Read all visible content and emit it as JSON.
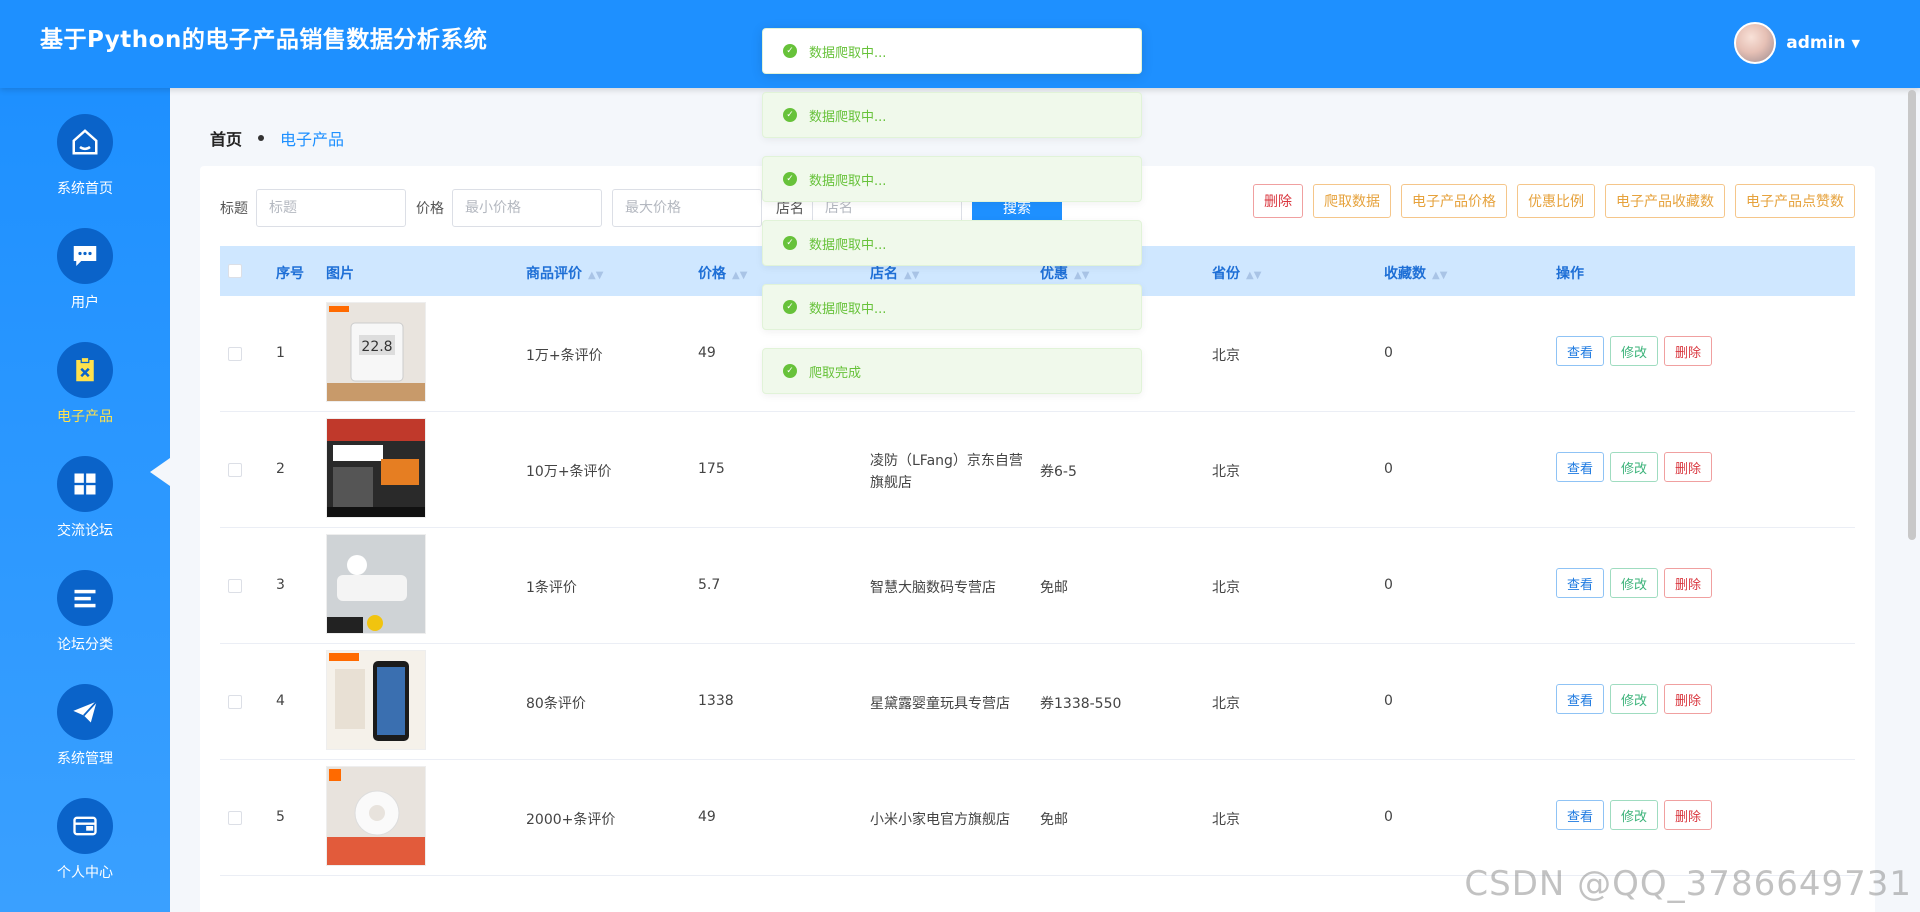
{
  "header": {
    "title": "基于Python的电子产品销售数据分析系统",
    "username": "admin"
  },
  "sidebar": {
    "items": [
      {
        "label": "系统首页",
        "icon": "home-icon"
      },
      {
        "label": "用户",
        "icon": "chat-icon"
      },
      {
        "label": "电子产品",
        "icon": "clipboard-icon"
      },
      {
        "label": "交流论坛",
        "icon": "grid-icon"
      },
      {
        "label": "论坛分类",
        "icon": "list-icon"
      },
      {
        "label": "系统管理",
        "icon": "paper-plane-icon"
      },
      {
        "label": "个人中心",
        "icon": "wallet-icon"
      }
    ],
    "active_index": 2
  },
  "breadcrumb": {
    "home": "首页",
    "current": "电子产品"
  },
  "search": {
    "title_label": "标题",
    "title_placeholder": "标题",
    "price_label": "价格",
    "min_placeholder": "最小价格",
    "max_placeholder": "最大价格",
    "shop_label": "店名",
    "shop_placeholder": "店名",
    "search_button": "搜索"
  },
  "actions": [
    "删除",
    "爬取数据",
    "电子产品价格",
    "优惠比例",
    "电子产品收藏数",
    "电子产品点赞数"
  ],
  "table": {
    "columns": [
      "序号",
      "图片",
      "商品评价",
      "价格",
      "店名",
      "优惠",
      "省份",
      "收藏数",
      "操作"
    ],
    "rows": [
      {
        "no": "1",
        "review": "1万+条评价",
        "price": "49",
        "shop": "",
        "discount": "",
        "province": "北京",
        "fav": "0"
      },
      {
        "no": "2",
        "review": "10万+条评价",
        "price": "175",
        "shop": "凌防（LFang）京东自营旗舰店",
        "discount": "券6-5",
        "province": "北京",
        "fav": "0"
      },
      {
        "no": "3",
        "review": "1条评价",
        "price": "5.7",
        "shop": "智慧大脑数码专营店",
        "discount": "免邮",
        "province": "北京",
        "fav": "0"
      },
      {
        "no": "4",
        "review": "80条评价",
        "price": "1338",
        "shop": "星黛露婴童玩具专营店",
        "discount": "券1338-550",
        "province": "北京",
        "fav": "0"
      },
      {
        "no": "5",
        "review": "2000+条评价",
        "price": "49",
        "shop": "小米小家电官方旗舰店",
        "discount": "免邮",
        "province": "北京",
        "fav": "0"
      }
    ],
    "op_view": "查看",
    "op_edit": "修改",
    "op_delete": "删除"
  },
  "notifications": [
    "数据爬取中...",
    "数据爬取中...",
    "数据爬取中...",
    "数据爬取中...",
    "数据爬取中...",
    "爬取完成"
  ],
  "watermark": "CSDN @QQ_3786649731",
  "colors": {
    "primary": "#1e90ff",
    "sidebar_icon_bg": "#0a63c9",
    "success": "#67c23a",
    "warning": "#e6a23c",
    "danger": "#d9363e"
  }
}
